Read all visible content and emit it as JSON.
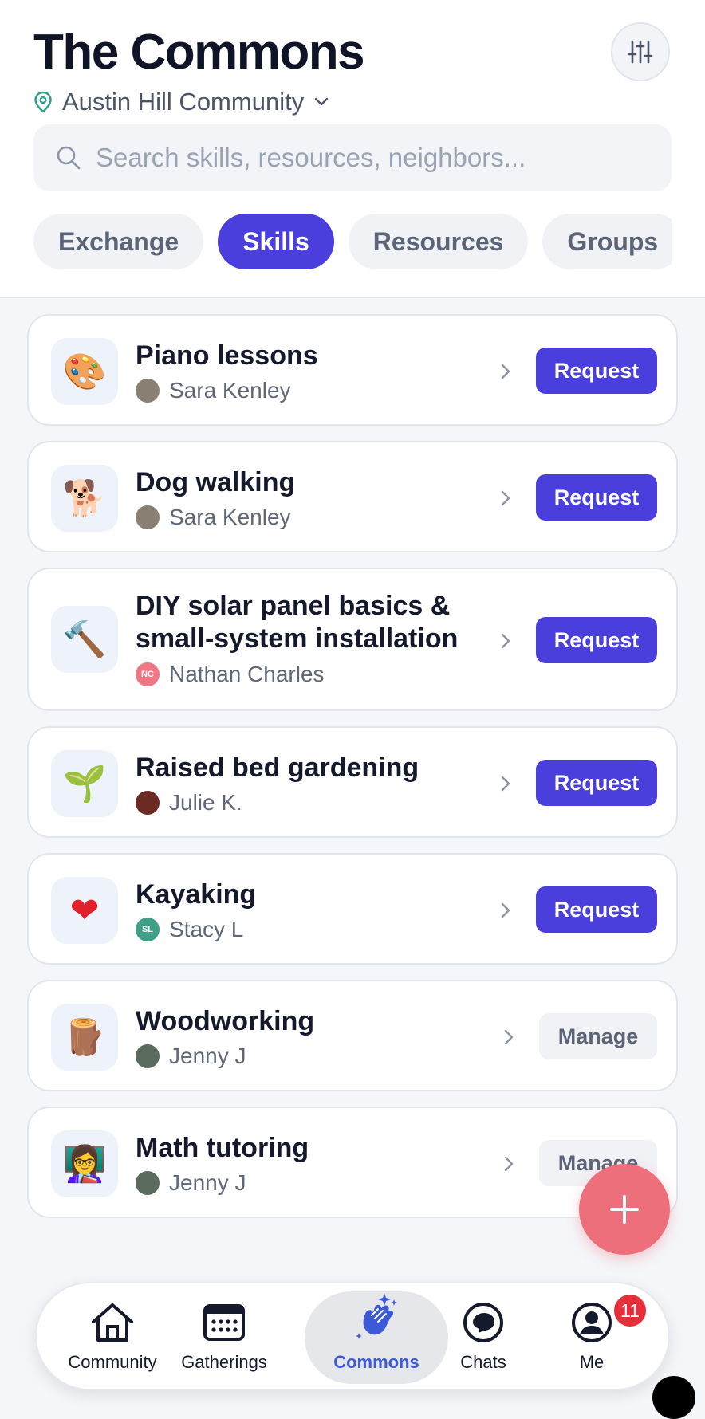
{
  "header": {
    "title": "The Commons",
    "filter_icon": "sliders-icon",
    "location": "Austin Hill Community"
  },
  "search": {
    "placeholder": "Search skills, resources, neighbors..."
  },
  "tabs": [
    {
      "label": "Exchange",
      "active": false
    },
    {
      "label": "Skills",
      "active": true
    },
    {
      "label": "Resources",
      "active": false
    },
    {
      "label": "Groups",
      "active": false
    }
  ],
  "listings": [
    {
      "title": "Piano lessons",
      "icon": "🎨",
      "owner": "Sara Kenley",
      "avatar_initials": "",
      "avatar_color": "#8a7f73",
      "action": "Request"
    },
    {
      "title": "Dog walking",
      "icon": "🐕",
      "owner": "Sara Kenley",
      "avatar_initials": "",
      "avatar_color": "#8a7f73",
      "action": "Request"
    },
    {
      "title": "DIY solar panel basics & small-system installation",
      "icon": "🔨",
      "owner": "Nathan Charles",
      "avatar_initials": "NC",
      "avatar_color": "#ef7784",
      "action": "Request"
    },
    {
      "title": "Raised bed gardening",
      "icon": "🌱",
      "owner": "Julie K.",
      "avatar_initials": "",
      "avatar_color": "#6b2a22",
      "action": "Request"
    },
    {
      "title": "Kayaking",
      "icon": "❤",
      "owner": "Stacy L",
      "avatar_initials": "SL",
      "avatar_color": "#3f9f86",
      "action": "Request"
    },
    {
      "title": "Woodworking",
      "icon": "🪵",
      "owner": "Jenny J",
      "avatar_initials": "",
      "avatar_color": "#5a6b5e",
      "action": "Manage"
    },
    {
      "title": "Math tutoring",
      "icon": "👩‍🏫",
      "owner": "Jenny J",
      "avatar_initials": "",
      "avatar_color": "#5a6b5e",
      "action": "Manage"
    }
  ],
  "fab": {
    "icon": "plus-icon"
  },
  "nav": [
    {
      "label": "Community",
      "icon": "home-icon"
    },
    {
      "label": "Gatherings",
      "icon": "calendar-icon"
    },
    {
      "label": "Commons",
      "icon": "clapping-hands-icon",
      "active": true
    },
    {
      "label": "Chats",
      "icon": "chat-bubble-icon"
    },
    {
      "label": "Me",
      "icon": "profile-icon",
      "badge": "11"
    }
  ],
  "colors": {
    "accent": "#4a3fdc",
    "fab": "#ee6f7c",
    "active_nav": "#3c5ad8",
    "badge": "#e5303a"
  }
}
